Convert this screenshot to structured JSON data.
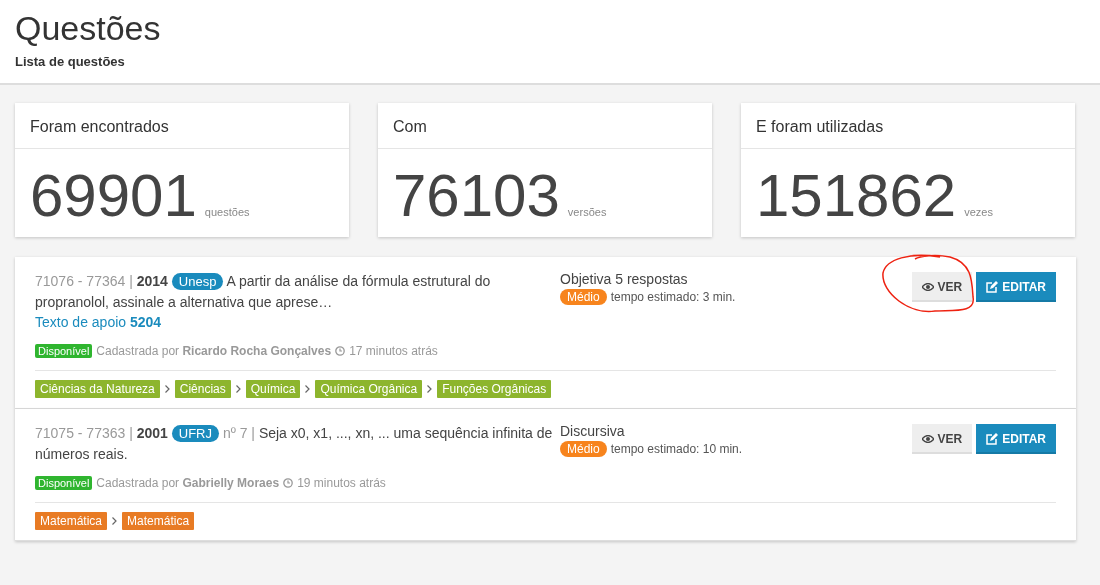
{
  "header": {
    "title": "Questões",
    "subtitle": "Lista de questões"
  },
  "stats": [
    {
      "label": "Foram encontrados",
      "value": "69901",
      "unit": "questões"
    },
    {
      "label": "Com",
      "value": "76103",
      "unit": "versões"
    },
    {
      "label": "E foram utilizadas",
      "value": "151862",
      "unit": "vezes"
    }
  ],
  "questions": [
    {
      "ids": "71076 - 77364 |",
      "year": "2014",
      "source": "Unesp",
      "text": "A partir da análise da fórmula estrutural do propranolol, assinale a alternativa que aprese…",
      "support_label": "Texto de apoio",
      "support_number": "5204",
      "type": "Objetiva 5 respostas",
      "difficulty": "Médio",
      "time": "tempo estimado: 3 min.",
      "status": "Disponível",
      "registered_prefix": "Cadastrada por",
      "author": "Ricardo Rocha Gonçalves",
      "ago": "17 minutos atrás",
      "view_label": "VER",
      "edit_label": "EDITAR",
      "circled": true,
      "tags": [
        {
          "label": "Ciências da Natureza",
          "color": "#8db52d"
        },
        {
          "label": "Ciências",
          "color": "#8db52d"
        },
        {
          "label": "Química",
          "color": "#8db52d"
        },
        {
          "label": "Química Orgânica",
          "color": "#8db52d"
        },
        {
          "label": "Funções Orgânicas",
          "color": "#8db52d"
        }
      ]
    },
    {
      "ids": "71075 - 77363 |",
      "year": "2001",
      "source": "UFRJ",
      "number": "nº 7 |",
      "text": "Seja x0, x1, ..., xn, ... uma sequência infinita de números reais.",
      "type": "Discursiva",
      "difficulty": "Médio",
      "time": "tempo estimado: 10 min.",
      "status": "Disponível",
      "registered_prefix": "Cadastrada por",
      "author": "Gabrielly Moraes",
      "ago": "19 minutos atrás",
      "view_label": "VER",
      "edit_label": "EDITAR",
      "circled": false,
      "tags": [
        {
          "label": "Matemática",
          "color": "#e87b24"
        },
        {
          "label": "Matemática",
          "color": "#e87b24"
        }
      ]
    }
  ]
}
